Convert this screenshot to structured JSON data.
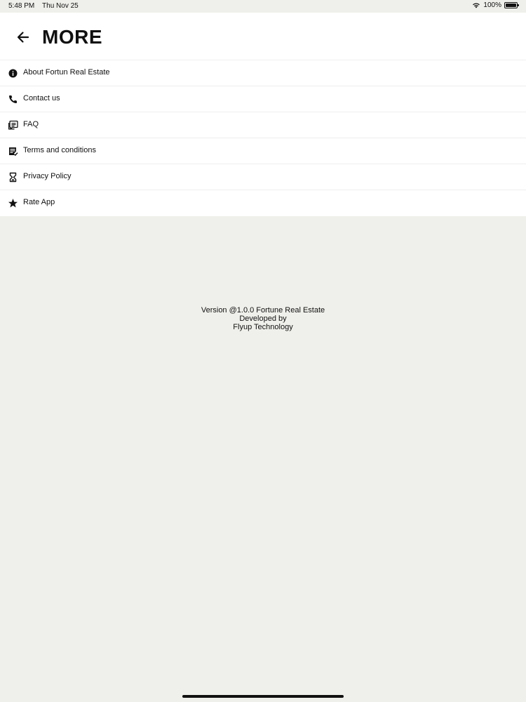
{
  "status_bar": {
    "time": "5:48 PM",
    "date": "Thu Nov 25",
    "battery_percent": "100%"
  },
  "header": {
    "title": "MORE"
  },
  "menu": {
    "items": [
      {
        "label": "About Fortun Real Estate",
        "icon": "info-icon"
      },
      {
        "label": "Contact us",
        "icon": "phone-icon"
      },
      {
        "label": "FAQ",
        "icon": "faq-icon"
      },
      {
        "label": "Terms and conditions",
        "icon": "terms-icon"
      },
      {
        "label": "Privacy Policy",
        "icon": "hourglass-icon"
      },
      {
        "label": "Rate App",
        "icon": "star-icon"
      }
    ]
  },
  "footer": {
    "version_line": "Version @1.0.0 Fortune Real Estate",
    "developed_line": "Developed by",
    "company_line": "Flyup Technology"
  },
  "colors": {
    "background": "#eff0eb",
    "surface": "#ffffff",
    "text": "#111111"
  }
}
